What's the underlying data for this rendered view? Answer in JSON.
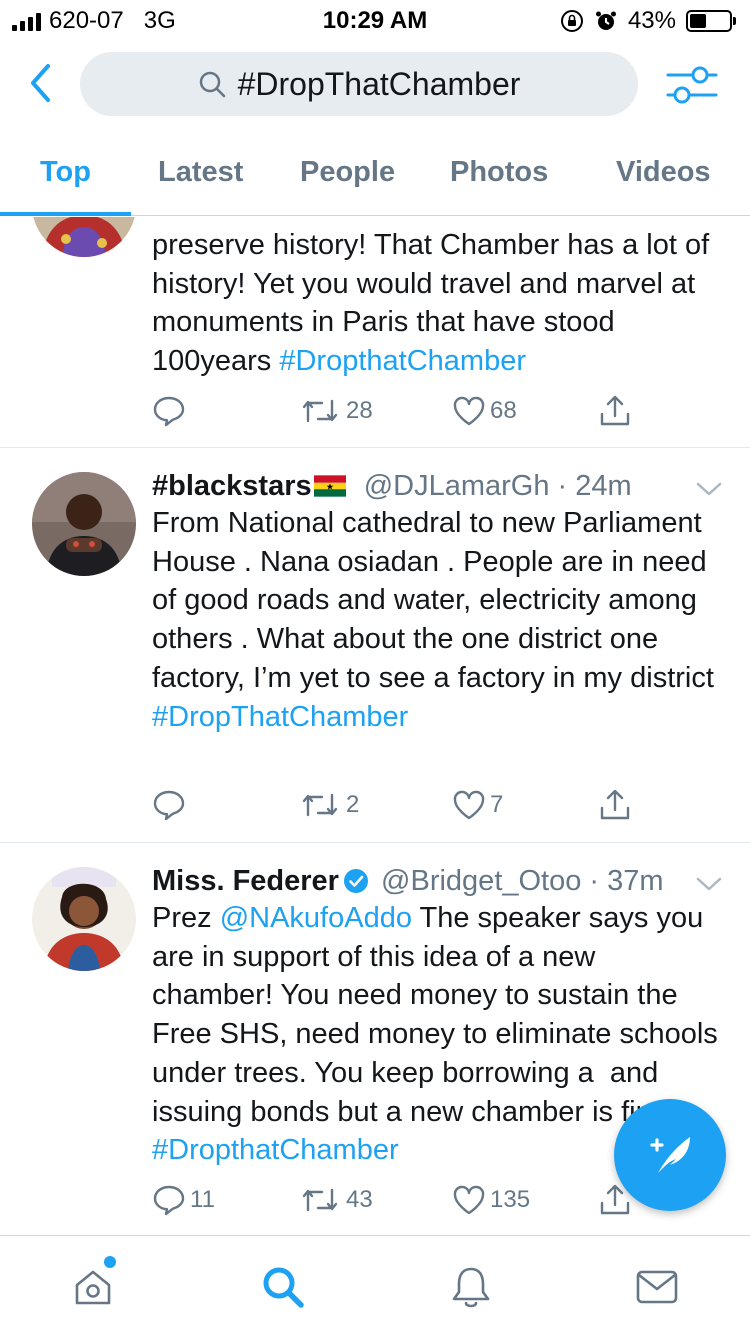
{
  "status_bar": {
    "carrier": "620-07",
    "network": "3G",
    "time": "10:29 AM",
    "battery_percent": "43%",
    "battery_level": 0.43
  },
  "search": {
    "query": "#DropThatChamber"
  },
  "tabs": [
    {
      "label": "Top",
      "active": true
    },
    {
      "label": "Latest",
      "active": false
    },
    {
      "label": "People",
      "active": false
    },
    {
      "label": "Photos",
      "active": false
    },
    {
      "label": "Videos",
      "active": false
    }
  ],
  "tweets": [
    {
      "body_parts": [
        {
          "text": "preserve history! That Chamber has a lot of history! Yet you would travel and marvel at monuments in Paris that have stood 100years ",
          "kind": "text"
        },
        {
          "text": "#DropthatChamber",
          "kind": "hashtag"
        }
      ],
      "replies": "",
      "retweets": "28",
      "likes": "68"
    },
    {
      "name": "#blackstars",
      "flag": "ghana-flag",
      "handle": "@DJLamarGh",
      "time": "24m",
      "body_parts": [
        {
          "text": "From National cathedral to new Parliament House . Nana osiadan . People are in need of good roads and water, electricity among others . What about the one district one factory, I’m yet to see a factory in my district\n",
          "kind": "text"
        },
        {
          "text": "#DropThatChamber",
          "kind": "hashtag"
        }
      ],
      "replies": "",
      "retweets": "2",
      "likes": "7"
    },
    {
      "name": "Miss. Federer",
      "verified": true,
      "handle": "@Bridget_Otoo",
      "time": "37m",
      "body_parts": [
        {
          "text": "Prez ",
          "kind": "text"
        },
        {
          "text": "@NAkufoAddo",
          "kind": "mention"
        },
        {
          "text": " The speaker says you are in support of this idea of a new chamber! You need money to sustain the Free SHS, need money to eliminate schools under trees. You keep borrowing a  and issuing bonds but a new chamber is fine? ",
          "kind": "text"
        },
        {
          "text": "#DropthatChamber",
          "kind": "hashtag"
        }
      ],
      "replies": "11",
      "retweets": "43",
      "likes": "135"
    }
  ],
  "colors": {
    "accent": "#1da1f2",
    "text": "#14171a",
    "secondary": "#657786"
  },
  "bottom_nav": [
    {
      "icon": "home-icon",
      "has_notification": true
    },
    {
      "icon": "search-icon",
      "active": true
    },
    {
      "icon": "bell-icon"
    },
    {
      "icon": "mail-icon"
    }
  ]
}
